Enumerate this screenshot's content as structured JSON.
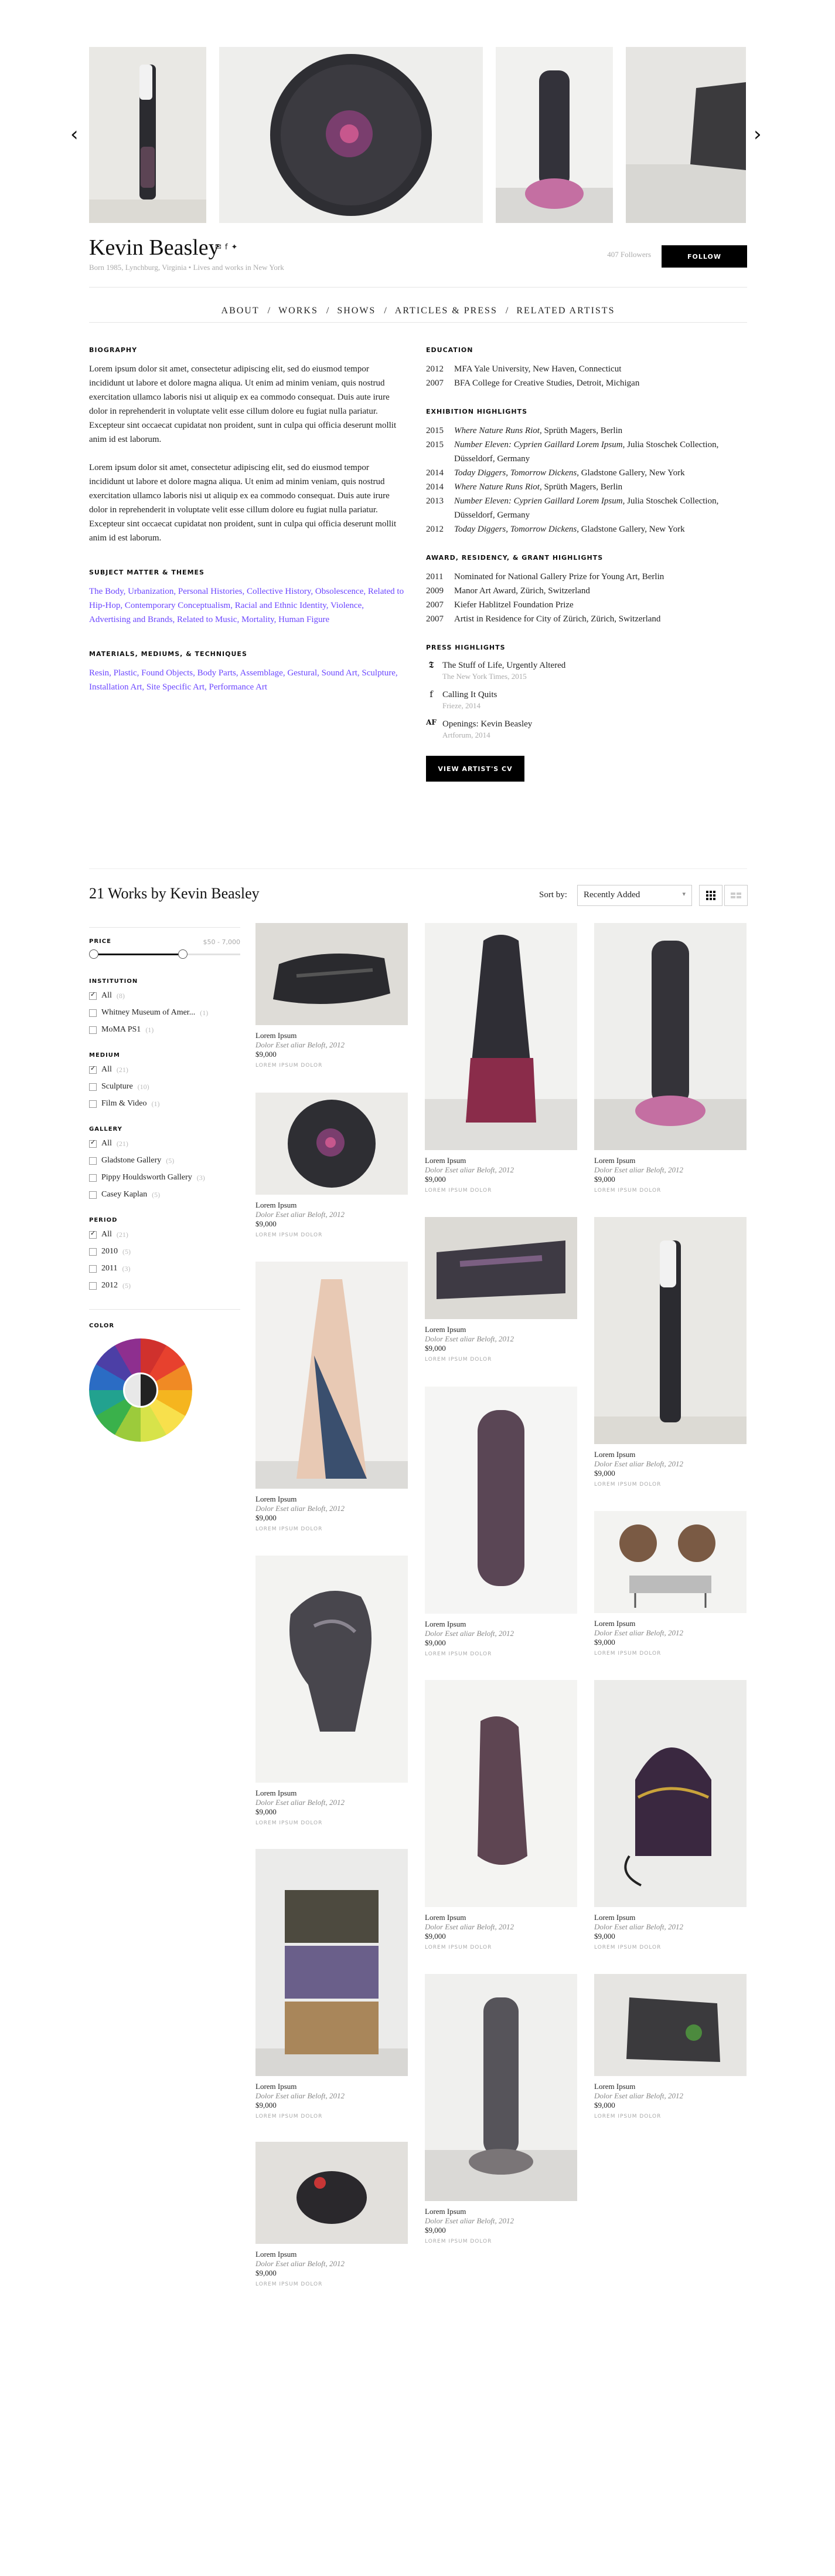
{
  "artist": {
    "name": "Kevin Beasley",
    "bio": "Born 1985, Lynchburg, Virginia • Lives and works in New York",
    "followers": "407 Followers",
    "follow_label": "FOLLOW"
  },
  "nav": {
    "items": [
      "ABOUT",
      "WORKS",
      "SHOWS",
      "ARTICLES & PRESS",
      "RELATED ARTISTS"
    ]
  },
  "about": {
    "biography_heading": "BIOGRAPHY",
    "paragraphs": [
      "Lorem ipsum dolor sit amet, consectetur adipiscing elit, sed do eiusmod tempor incididunt ut labore et dolore magna aliqua. Ut enim ad minim veniam, quis nostrud exercitation ullamco laboris nisi ut aliquip ex ea commodo consequat. Duis aute irure dolor in reprehenderit in voluptate velit esse cillum dolore eu fugiat nulla pariatur. Excepteur sint occaecat cupidatat non proident, sunt in culpa qui officia deserunt mollit anim id est laborum.",
      "Lorem ipsum dolor sit amet, consectetur adipiscing elit, sed do eiusmod tempor incididunt ut labore et dolore magna aliqua. Ut enim ad minim veniam, quis nostrud exercitation ullamco laboris nisi ut aliquip ex ea commodo consequat. Duis aute irure dolor in reprehenderit in voluptate velit esse cillum dolore eu fugiat nulla pariatur. Excepteur sint occaecat cupidatat non proident, sunt in culpa qui officia deserunt mollit anim id est laborum."
    ],
    "subject_heading": "SUBJECT MATTER & THEMES",
    "subjects": "The Body, Urbanization, Personal Histories, Collective History, Obsolescence, Related to Hip-Hop, Contemporary Conceptualism, Racial and Ethnic Identity, Violence, Advertising and Brands, Related to Music, Mortality, Human Figure",
    "materials_heading": "MATERIALS, MEDIUMS, & TECHNIQUES",
    "materials": "Resin, Plastic, Found Objects, Body Parts, Assemblage, Gestural, Sound Art, Sculpture, Installation Art, Site Specific Art, Performance Art",
    "education_heading": "EDUCATION",
    "education": [
      {
        "year": "2012",
        "text": "MFA Yale University, New Haven, Connecticut"
      },
      {
        "year": "2007",
        "text": "BFA College for Creative Studies, Detroit, Michigan"
      }
    ],
    "exhibitions_heading": "EXHIBITION HIGHLIGHTS",
    "exhibitions": [
      {
        "year": "2015",
        "title": "Where Nature Runs Riot",
        "rest": ", Sprüth Magers, Berlin"
      },
      {
        "year": "2015",
        "title": "Number Eleven: Cyprien Gaillard Lorem Ipsum",
        "rest": ", Julia Stoschek Collection, Düsseldorf, Germany"
      },
      {
        "year": "2014",
        "title": "Today Diggers, Tomorrow Dickens",
        "rest": ", Gladstone Gallery, New York"
      },
      {
        "year": "2014",
        "title": "Where Nature Runs Riot",
        "rest": ", Sprüth Magers, Berlin"
      },
      {
        "year": "2013",
        "title": "Number Eleven: Cyprien Gaillard Lorem Ipsum",
        "rest": ", Julia Stoschek Collection, Düsseldorf, Germany"
      },
      {
        "year": "2012",
        "title": "Today Diggers, Tomorrow Dickens",
        "rest": ", Gladstone Gallery, New York"
      }
    ],
    "awards_heading": "AWARD, RESIDENCY, & GRANT HIGHLIGHTS",
    "awards": [
      {
        "year": "2011",
        "text": "Nominated for National Gallery Prize for Young Art, Berlin"
      },
      {
        "year": "2009",
        "text": "Manor Art Award, Zürich, Switzerland"
      },
      {
        "year": "2007",
        "text": "Kiefer Hablitzel Foundation Prize"
      },
      {
        "year": "2007",
        "text": "Artist in Residence for City of Zürich, Zürich, Switzerland"
      }
    ],
    "press_heading": "PRESS HIGHLIGHTS",
    "press": [
      {
        "icon": "𝕿",
        "title": "The Stuff of Life, Urgently Altered",
        "source": "The New York Times, 2015"
      },
      {
        "icon": "f",
        "title": "Calling It Quits",
        "source": "Frieze, 2014"
      },
      {
        "icon": "AF",
        "title": "Openings: Kevin Beasley",
        "source": "Artforum, 2014"
      }
    ],
    "cv_label": "VIEW ARTIST'S CV"
  },
  "works": {
    "title": "21 Works by Kevin Beasley",
    "sort_label": "Sort by:",
    "sort_value": "Recently Added"
  },
  "filters": {
    "price": {
      "label": "PRICE",
      "range": "$50 - 7,000"
    },
    "institution": {
      "label": "INSTITUTION",
      "items": [
        {
          "label": "All",
          "count": "(8)",
          "checked": true
        },
        {
          "label": "Whitney Museum of Amer...",
          "count": "(1)",
          "checked": false
        },
        {
          "label": "MoMA PS1",
          "count": "(1)",
          "checked": false
        }
      ]
    },
    "medium": {
      "label": "MEDIUM",
      "items": [
        {
          "label": "All",
          "count": "(21)",
          "checked": true
        },
        {
          "label": "Sculpture",
          "count": "(10)",
          "checked": false
        },
        {
          "label": "Film & Video",
          "count": "(1)",
          "checked": false
        }
      ]
    },
    "gallery": {
      "label": "GALLERY",
      "items": [
        {
          "label": "All",
          "count": "(21)",
          "checked": true
        },
        {
          "label": "Gladstone Gallery",
          "count": "(5)",
          "checked": false
        },
        {
          "label": "Pippy Houldsworth Gallery",
          "count": "(3)",
          "checked": false
        },
        {
          "label": "Casey Kaplan",
          "count": "(5)",
          "checked": false
        }
      ]
    },
    "period": {
      "label": "PERIOD",
      "items": [
        {
          "label": "All",
          "count": "(21)",
          "checked": true
        },
        {
          "label": "2010",
          "count": "(5)",
          "checked": false
        },
        {
          "label": "2011",
          "count": "(3)",
          "checked": false
        },
        {
          "label": "2012",
          "count": "(5)",
          "checked": false
        }
      ]
    },
    "color": {
      "label": "COLOR"
    }
  },
  "artwork": {
    "title": "Lorem Ipsum",
    "subtitle": "Dolor Eset aliar Beloft, 2012",
    "price": "$9,000",
    "meta": "LOREM IPSUM DOLOR"
  },
  "colors": {
    "accent_link": "#6b46ff",
    "button_bg": "#000000",
    "muted_text": "#aaaaaa"
  }
}
